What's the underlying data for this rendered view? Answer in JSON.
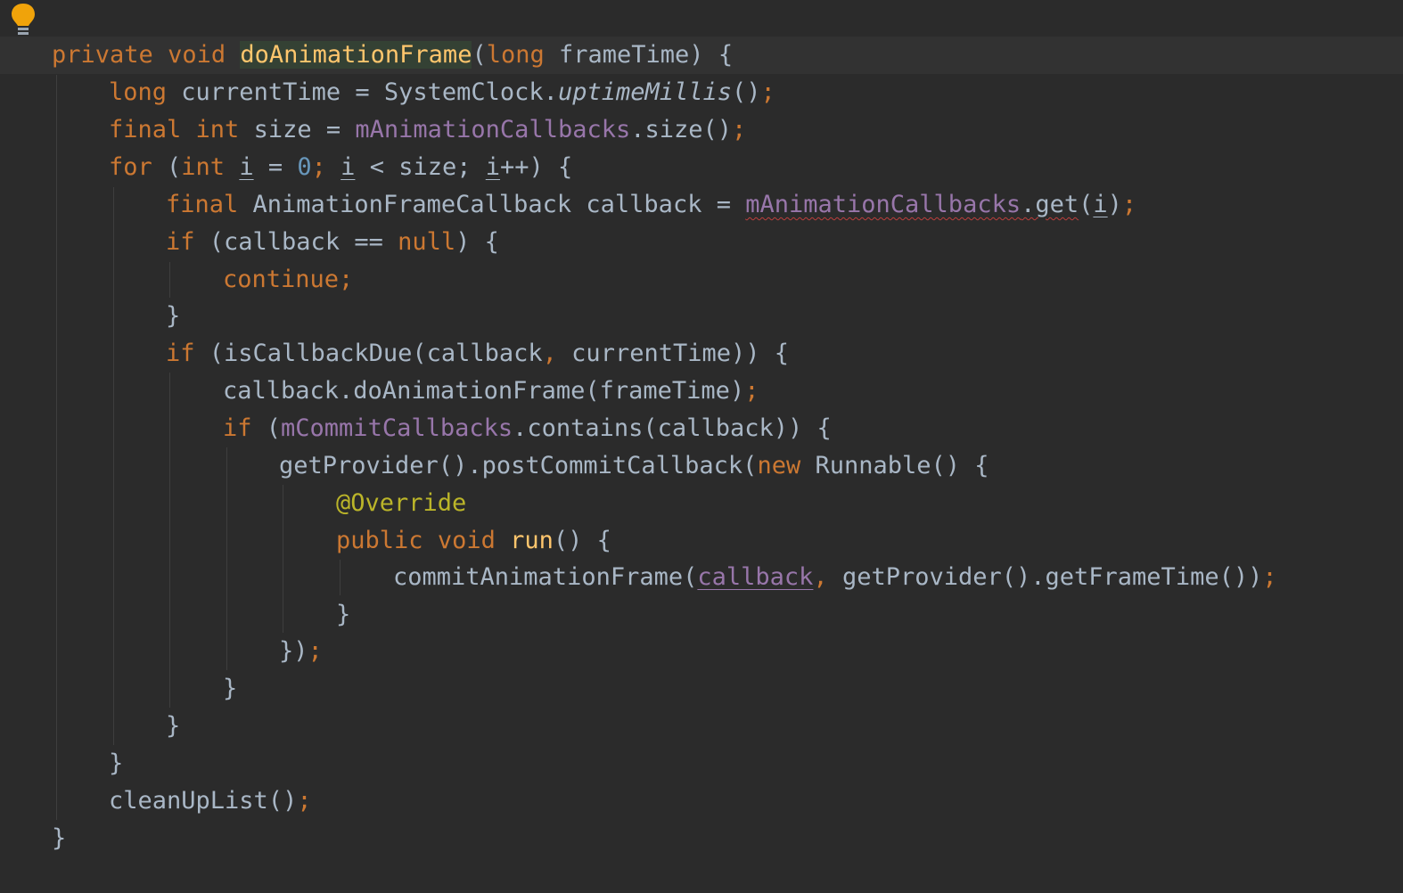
{
  "editor": {
    "accent_keyword": "#cc7832",
    "accent_function": "#ffc66d",
    "accent_field": "#9876aa",
    "accent_number": "#6897bb",
    "accent_annotation": "#bbb529",
    "default_text": "#a9b7c6",
    "background": "#2b2b2b",
    "gutter_icon": "lightbulb-icon"
  },
  "code": {
    "l1": {
      "a": "private",
      "b": " ",
      "c": "void",
      "d": " ",
      "e": "doAnimationFrame",
      "f": "(",
      "g": "long",
      "h": " frameTime) {"
    },
    "l2": {
      "a": "long",
      "b": " currentTime = SystemClock.",
      "c": "uptimeMillis",
      "d": "()",
      "e": ";"
    },
    "l3": {
      "a": "final",
      "b": " ",
      "c": "int",
      "d": " size = ",
      "e": "mAnimationCallbacks",
      "f": ".size()",
      "g": ";"
    },
    "l4": {
      "a": "for",
      "b": " (",
      "c": "int",
      "d": " ",
      "e": "i",
      "f": " = ",
      "g": "0",
      "h": "; ",
      "i": "i",
      "j": " < size; ",
      "k": "i",
      "l": "++) {"
    },
    "l5": {
      "a": "final",
      "b": " AnimationFrameCallback callback = ",
      "c": "mAnimationCallbacks",
      "d": ".get",
      "e": "(",
      "f": "i",
      "g": ")",
      "h": ";"
    },
    "l6": {
      "a": "if",
      "b": " (callback == ",
      "c": "null",
      "d": ") {"
    },
    "l7": {
      "a": "continue",
      "b": ";"
    },
    "l8": {
      "a": "}"
    },
    "l9": {
      "a": "if",
      "b": " (isCallbackDue(callback",
      "c": ",",
      "d": " currentTime)) {"
    },
    "l10": {
      "a": "callback.doAnimationFrame(frameTime)",
      "b": ";"
    },
    "l11": {
      "a": "if",
      "b": " (",
      "c": "mCommitCallbacks",
      "d": ".contains(callback)) {"
    },
    "l12": {
      "a": "getProvider().postCommitCallback(",
      "b": "new",
      "c": " Runnable() {"
    },
    "l13": {
      "a": "@Override"
    },
    "l14": {
      "a": "public",
      "b": " ",
      "c": "void",
      "d": " ",
      "e": "run",
      "f": "() {"
    },
    "l15": {
      "a": "commitAnimationFrame(",
      "b": "callback",
      "c": ",",
      "d": " getProvider().getFrameTime())",
      "e": ";"
    },
    "l16": {
      "a": "}"
    },
    "l17": {
      "a": "})",
      "b": ";"
    },
    "l18": {
      "a": "}"
    },
    "l19": {
      "a": "}"
    },
    "l20": {
      "a": "}"
    },
    "l21": {
      "a": "cleanUpList()",
      "b": ";"
    },
    "l22": {
      "a": "}"
    }
  }
}
